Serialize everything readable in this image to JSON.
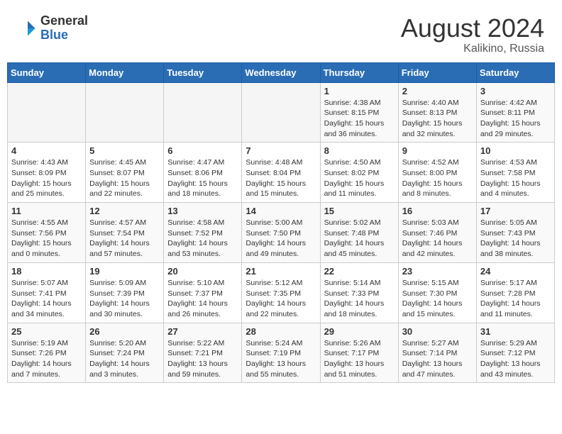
{
  "header": {
    "logo_general": "General",
    "logo_blue": "Blue",
    "month_year": "August 2024",
    "location": "Kalikino, Russia"
  },
  "weekdays": [
    "Sunday",
    "Monday",
    "Tuesday",
    "Wednesday",
    "Thursday",
    "Friday",
    "Saturday"
  ],
  "weeks": [
    [
      {
        "day": "",
        "info": ""
      },
      {
        "day": "",
        "info": ""
      },
      {
        "day": "",
        "info": ""
      },
      {
        "day": "",
        "info": ""
      },
      {
        "day": "1",
        "info": "Sunrise: 4:38 AM\nSunset: 8:15 PM\nDaylight: 15 hours\nand 36 minutes."
      },
      {
        "day": "2",
        "info": "Sunrise: 4:40 AM\nSunset: 8:13 PM\nDaylight: 15 hours\nand 32 minutes."
      },
      {
        "day": "3",
        "info": "Sunrise: 4:42 AM\nSunset: 8:11 PM\nDaylight: 15 hours\nand 29 minutes."
      }
    ],
    [
      {
        "day": "4",
        "info": "Sunrise: 4:43 AM\nSunset: 8:09 PM\nDaylight: 15 hours\nand 25 minutes."
      },
      {
        "day": "5",
        "info": "Sunrise: 4:45 AM\nSunset: 8:07 PM\nDaylight: 15 hours\nand 22 minutes."
      },
      {
        "day": "6",
        "info": "Sunrise: 4:47 AM\nSunset: 8:06 PM\nDaylight: 15 hours\nand 18 minutes."
      },
      {
        "day": "7",
        "info": "Sunrise: 4:48 AM\nSunset: 8:04 PM\nDaylight: 15 hours\nand 15 minutes."
      },
      {
        "day": "8",
        "info": "Sunrise: 4:50 AM\nSunset: 8:02 PM\nDaylight: 15 hours\nand 11 minutes."
      },
      {
        "day": "9",
        "info": "Sunrise: 4:52 AM\nSunset: 8:00 PM\nDaylight: 15 hours\nand 8 minutes."
      },
      {
        "day": "10",
        "info": "Sunrise: 4:53 AM\nSunset: 7:58 PM\nDaylight: 15 hours\nand 4 minutes."
      }
    ],
    [
      {
        "day": "11",
        "info": "Sunrise: 4:55 AM\nSunset: 7:56 PM\nDaylight: 15 hours\nand 0 minutes."
      },
      {
        "day": "12",
        "info": "Sunrise: 4:57 AM\nSunset: 7:54 PM\nDaylight: 14 hours\nand 57 minutes."
      },
      {
        "day": "13",
        "info": "Sunrise: 4:58 AM\nSunset: 7:52 PM\nDaylight: 14 hours\nand 53 minutes."
      },
      {
        "day": "14",
        "info": "Sunrise: 5:00 AM\nSunset: 7:50 PM\nDaylight: 14 hours\nand 49 minutes."
      },
      {
        "day": "15",
        "info": "Sunrise: 5:02 AM\nSunset: 7:48 PM\nDaylight: 14 hours\nand 45 minutes."
      },
      {
        "day": "16",
        "info": "Sunrise: 5:03 AM\nSunset: 7:46 PM\nDaylight: 14 hours\nand 42 minutes."
      },
      {
        "day": "17",
        "info": "Sunrise: 5:05 AM\nSunset: 7:43 PM\nDaylight: 14 hours\nand 38 minutes."
      }
    ],
    [
      {
        "day": "18",
        "info": "Sunrise: 5:07 AM\nSunset: 7:41 PM\nDaylight: 14 hours\nand 34 minutes."
      },
      {
        "day": "19",
        "info": "Sunrise: 5:09 AM\nSunset: 7:39 PM\nDaylight: 14 hours\nand 30 minutes."
      },
      {
        "day": "20",
        "info": "Sunrise: 5:10 AM\nSunset: 7:37 PM\nDaylight: 14 hours\nand 26 minutes."
      },
      {
        "day": "21",
        "info": "Sunrise: 5:12 AM\nSunset: 7:35 PM\nDaylight: 14 hours\nand 22 minutes."
      },
      {
        "day": "22",
        "info": "Sunrise: 5:14 AM\nSunset: 7:33 PM\nDaylight: 14 hours\nand 18 minutes."
      },
      {
        "day": "23",
        "info": "Sunrise: 5:15 AM\nSunset: 7:30 PM\nDaylight: 14 hours\nand 15 minutes."
      },
      {
        "day": "24",
        "info": "Sunrise: 5:17 AM\nSunset: 7:28 PM\nDaylight: 14 hours\nand 11 minutes."
      }
    ],
    [
      {
        "day": "25",
        "info": "Sunrise: 5:19 AM\nSunset: 7:26 PM\nDaylight: 14 hours\nand 7 minutes."
      },
      {
        "day": "26",
        "info": "Sunrise: 5:20 AM\nSunset: 7:24 PM\nDaylight: 14 hours\nand 3 minutes."
      },
      {
        "day": "27",
        "info": "Sunrise: 5:22 AM\nSunset: 7:21 PM\nDaylight: 13 hours\nand 59 minutes."
      },
      {
        "day": "28",
        "info": "Sunrise: 5:24 AM\nSunset: 7:19 PM\nDaylight: 13 hours\nand 55 minutes."
      },
      {
        "day": "29",
        "info": "Sunrise: 5:26 AM\nSunset: 7:17 PM\nDaylight: 13 hours\nand 51 minutes."
      },
      {
        "day": "30",
        "info": "Sunrise: 5:27 AM\nSunset: 7:14 PM\nDaylight: 13 hours\nand 47 minutes."
      },
      {
        "day": "31",
        "info": "Sunrise: 5:29 AM\nSunset: 7:12 PM\nDaylight: 13 hours\nand 43 minutes."
      }
    ]
  ]
}
